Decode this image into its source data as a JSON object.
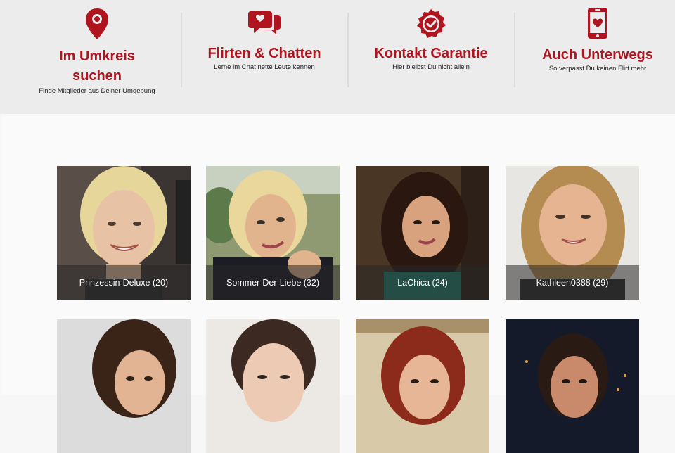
{
  "features": [
    {
      "title": "Im Umkreis suchen",
      "subtitle": "Finde Mitglieder aus Deiner Umgebung",
      "icon": "map-pin-icon"
    },
    {
      "title": "Flirten & Chatten",
      "subtitle": "Lerne im Chat nette Leute kennen",
      "icon": "chat-heart-icon"
    },
    {
      "title": "Kontakt Garantie",
      "subtitle": "Hier bleibst Du nicht allein",
      "icon": "check-badge-icon"
    },
    {
      "title": "Auch Unterwegs",
      "subtitle": "So verpasst Du keinen Flirt mehr",
      "icon": "phone-heart-icon"
    }
  ],
  "accent_color": "#b0141f",
  "profiles": [
    {
      "caption": "Prinzessin-Deluxe (20)"
    },
    {
      "caption": "Sommer-Der-Liebe (32)"
    },
    {
      "caption": "LaChica (24)"
    },
    {
      "caption": "Kathleen0388 (29)"
    },
    {
      "caption": ""
    },
    {
      "caption": ""
    },
    {
      "caption": ""
    },
    {
      "caption": ""
    }
  ]
}
